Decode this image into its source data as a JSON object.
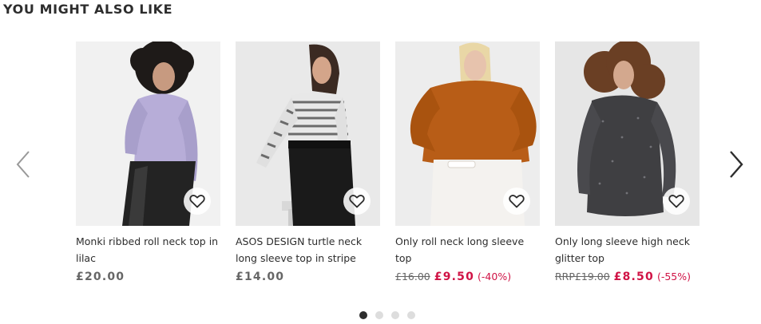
{
  "section": {
    "title": "YOU MIGHT ALSO LIKE"
  },
  "icons": {
    "prev": "chevron-left-icon",
    "next": "chevron-right-icon",
    "save": "heart-icon"
  },
  "colors": {
    "text": "#2d2d2d",
    "sale": "#d01345",
    "muted": "#666666"
  },
  "products": [
    {
      "name": "Monki ribbed roll neck top in lilac",
      "price": "£20.00"
    },
    {
      "name": "ASOS DESIGN turtle neck long sleeve top in stripe",
      "price": "£14.00"
    },
    {
      "name": "Only roll neck long sleeve top",
      "was": "£16.00",
      "now": "£9.50",
      "discount": "(-40%)"
    },
    {
      "name": "Only long sleeve high neck glitter top",
      "was": "RRP£19.00",
      "now": "£8.50",
      "discount": "(-55%)"
    }
  ],
  "pagination": {
    "total": 4,
    "active": 1
  }
}
